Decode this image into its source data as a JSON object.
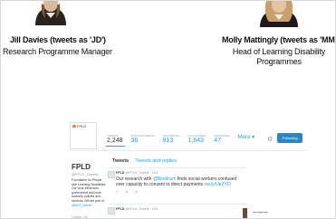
{
  "people": {
    "jd": {
      "name": "Jill Davies (tweets as 'JD')",
      "role": "Research Programme Manager"
    },
    "mm": {
      "name": "Molly Mattingly (tweets as 'MM')",
      "role": "Head of Learning Disability Programmes"
    }
  },
  "profile": {
    "card_logo": "FPLD",
    "stats": [
      {
        "label": "TWEETS",
        "value": "2,248"
      },
      {
        "label": "PHOTOS/VIDEOS",
        "value": "36"
      },
      {
        "label": "FOLLOWING",
        "value": "813"
      },
      {
        "label": "FOLLOWERS",
        "value": "1,643"
      },
      {
        "label": "FAVORITES",
        "value": "47"
      },
      {
        "label": "",
        "value": "More ▾"
      }
    ],
    "follow_label": "Following",
    "name": "FPLD",
    "handle": "@FPLD_Tweets",
    "bio": "Foundation for People with Learning Disabilities. Our work influences government and local authority policies and services. We are part of",
    "bio_link": "@MHF_tweets",
    "location": "London, UK"
  },
  "tabs": {
    "tweets": "Tweets",
    "replies": "Tweets and replies"
  },
  "tweets": [
    {
      "author": "FPLD",
      "handle": "@FPLD_Tweets · 16h",
      "text_before": "Our research with",
      "mention": "@Bindlcum",
      "text_after": "finds social workers confused over capacity to consent to direct payments",
      "link": "ow.ly/UeZYO"
    },
    {
      "author": "FPLD",
      "handle": "@FPLD_Tweets · 16h"
    }
  ],
  "colors": {
    "accent": "#1da1f2",
    "follow_button": "#2b86c5"
  }
}
